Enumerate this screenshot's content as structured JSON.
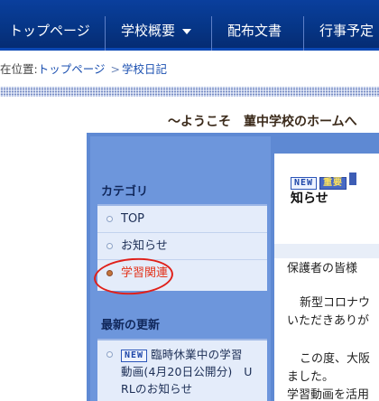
{
  "nav": {
    "items": [
      "トップページ",
      "学校概要",
      "配布文書",
      "行事予定"
    ]
  },
  "breadcrumb": {
    "prefix": "在位置:",
    "links": [
      "トップページ",
      "学校日記"
    ],
    "separator": ">"
  },
  "welcome": "～ようこそ　菫中学校のホームへ",
  "sidebar": {
    "category_heading": "カテゴリ",
    "categories": [
      "TOP",
      "お知らせ",
      "学習関連"
    ],
    "active_category": "学習関連",
    "recent_heading": "最新の更新",
    "recent": {
      "badge": "NEW",
      "lines": [
        "臨時休業中の学習",
        "動画(4月20日公開分)　U",
        "RLのお知らせ"
      ]
    }
  },
  "content": {
    "badges": [
      "NEW",
      "重要"
    ],
    "title": "知らせ",
    "lines": [
      "保護者の皆様",
      "新型コロナウ",
      "いただきありが",
      "この度、大阪",
      "ました。",
      "学習動画を活用"
    ]
  },
  "colors": {
    "nav_bg": "#063585",
    "main_bg": "#5e89d3",
    "active_link": "#e3321a",
    "annotation_circle": "#e0201a"
  }
}
